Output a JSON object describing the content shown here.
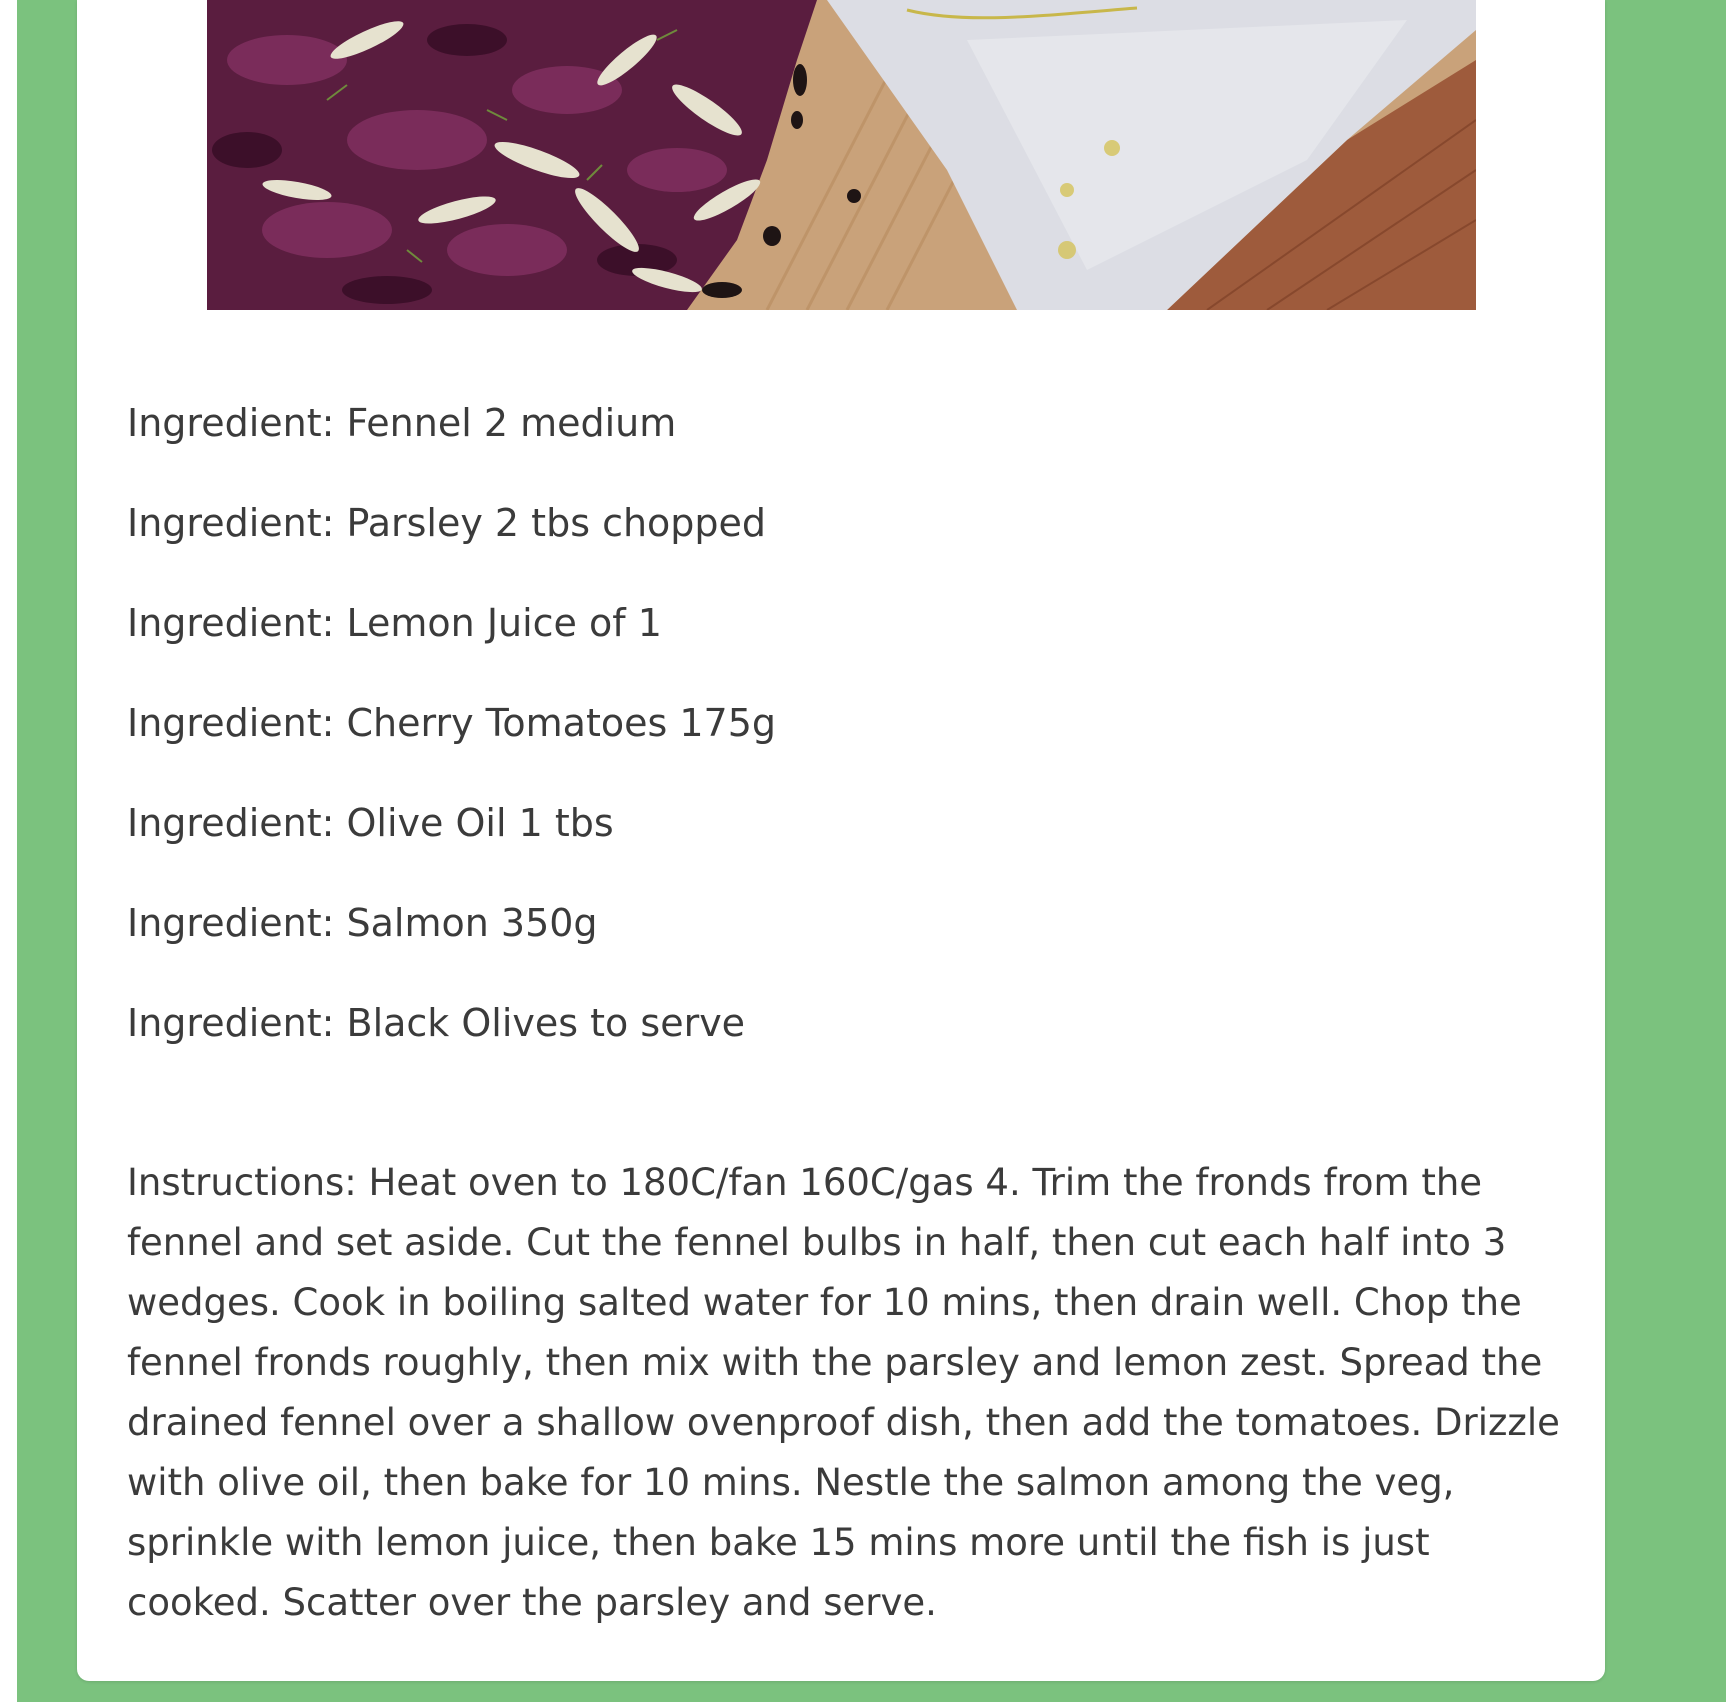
{
  "recipe": {
    "image": {
      "icon": "recipe-photo-salmon-fennel",
      "colors": {
        "cabbage": "#5a1d3f",
        "board": "#c9a27a",
        "paper": "#dcdde4",
        "dark_wood": "#9e5b3c"
      }
    },
    "ingredients": [
      "Ingredient: Fennel 2 medium",
      "Ingredient: Parsley 2 tbs chopped",
      "Ingredient: Lemon Juice of 1",
      "Ingredient: Cherry Tomatoes 175g",
      "Ingredient: Olive Oil 1 tbs",
      "Ingredient: Salmon 350g",
      "Ingredient: Black Olives to serve"
    ],
    "instructions": "Instructions: Heat oven to 180C/fan 160C/gas 4. Trim the fronds from the fennel and set aside. Cut the fennel bulbs in half, then cut each half into 3 wedges. Cook in boiling salted water for 10 mins, then drain well. Chop the fennel fronds roughly, then mix with the parsley and lemon zest. Spread the drained fennel over a shallow ovenproof dish, then add the tomatoes. Drizzle with olive oil, then bake for 10 mins. Nestle the salmon among the veg, sprinkle with lemon juice, then bake 15 mins more until the fish is just cooked. Scatter over the parsley and serve."
  },
  "theme": {
    "page_bg": "#7bc27e",
    "card_bg": "#ffffff",
    "text": "#3b3b3b"
  }
}
